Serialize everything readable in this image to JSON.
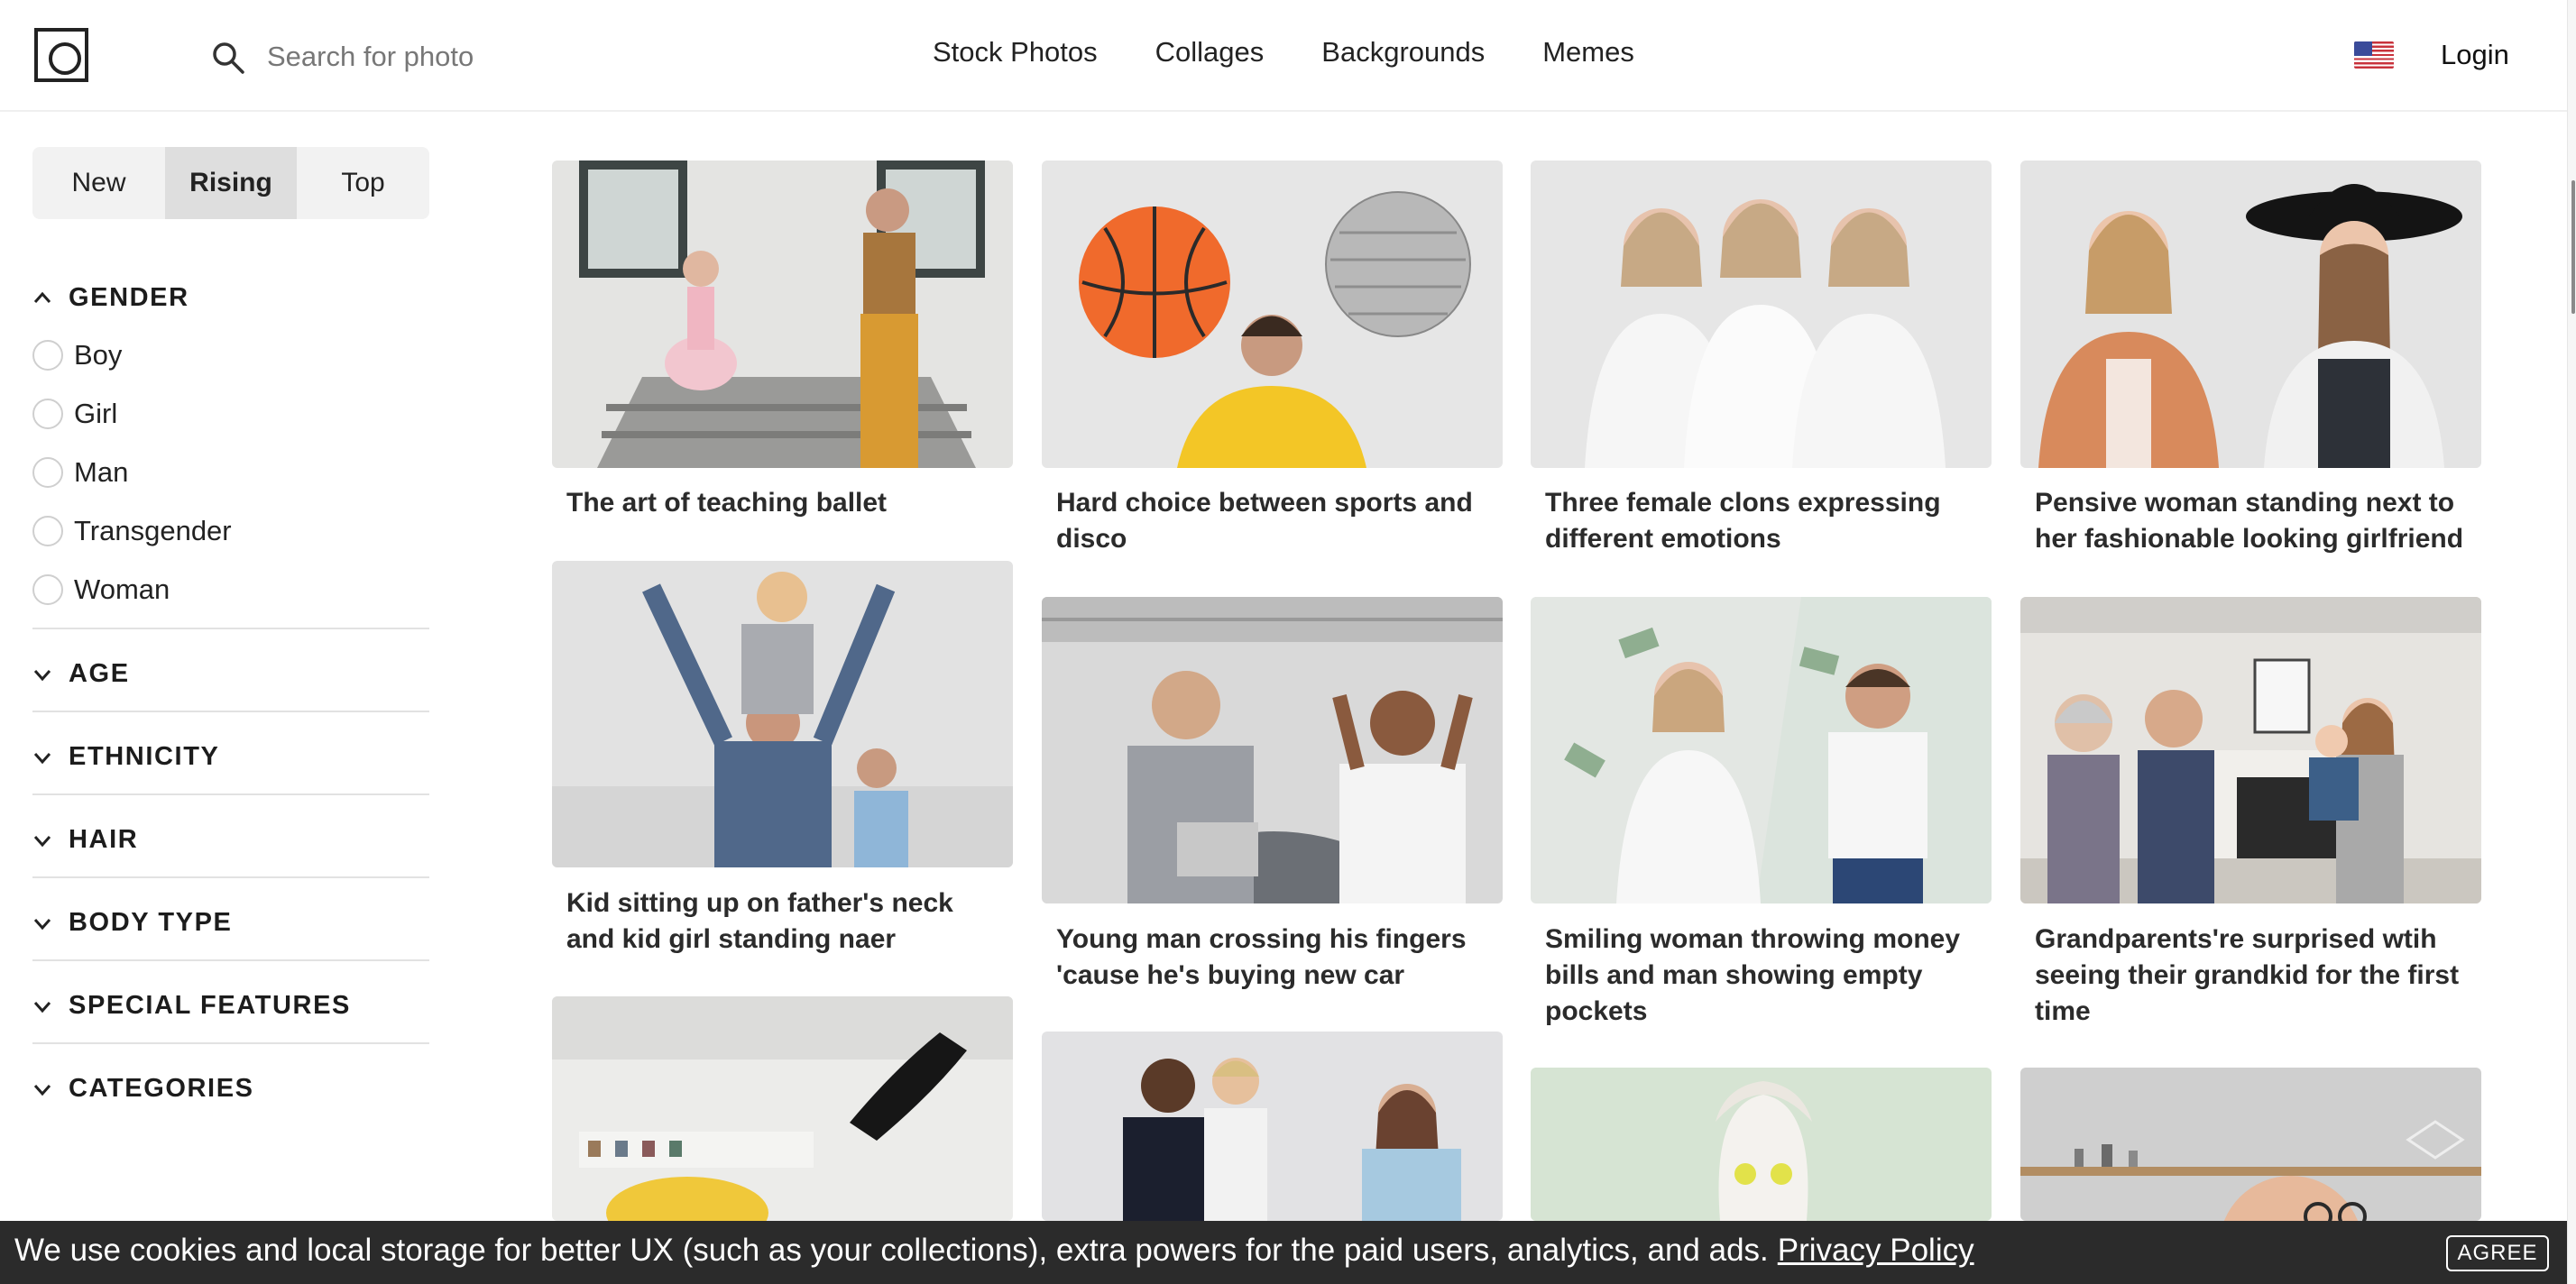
{
  "header": {
    "search_placeholder": "Search for photo",
    "nav": [
      "Stock Photos",
      "Collages",
      "Backgrounds",
      "Memes"
    ],
    "login": "Login"
  },
  "sidebar": {
    "sort_tabs": [
      "New",
      "Rising",
      "Top"
    ],
    "active_sort": "Rising",
    "filters": [
      {
        "title": "GENDER",
        "expanded": true,
        "options": [
          "Boy",
          "Girl",
          "Man",
          "Transgender",
          "Woman"
        ]
      },
      {
        "title": "AGE",
        "expanded": false
      },
      {
        "title": "ETHNICITY",
        "expanded": false
      },
      {
        "title": "HAIR",
        "expanded": false
      },
      {
        "title": "BODY TYPE",
        "expanded": false
      },
      {
        "title": "SPECIAL FEATURES",
        "expanded": false
      },
      {
        "title": "CATEGORIES",
        "expanded": false
      }
    ]
  },
  "photos": [
    {
      "caption": "The art of teaching ballet"
    },
    {
      "caption": "Hard choice between sports and disco"
    },
    {
      "caption": "Three female clons expressing different emotions"
    },
    {
      "caption": "Pensive woman standing next to her fashionable looking girlfriend"
    },
    {
      "caption": "Kid sitting up on father's neck and kid girl standing naer"
    },
    {
      "caption": "Young man crossing his fingers 'cause he's buying new car"
    },
    {
      "caption": "Smiling woman throwing money bills and man showing empty pockets"
    },
    {
      "caption": "Grandparents're surprised wtih seeing their grandkid for the first time"
    },
    {
      "caption": ""
    },
    {
      "caption": ""
    },
    {
      "caption": ""
    },
    {
      "caption": ""
    }
  ],
  "cookie": {
    "text": "We use cookies and local storage for better UX (such as your collections), extra powers for the paid users, analytics, and ads.",
    "link": "Privacy Policy",
    "button": "AGREE"
  },
  "colors": {
    "cookie_bar": "#2b2b2b",
    "active_tab": "#dedede",
    "tab_bg": "#f2f2f2"
  }
}
